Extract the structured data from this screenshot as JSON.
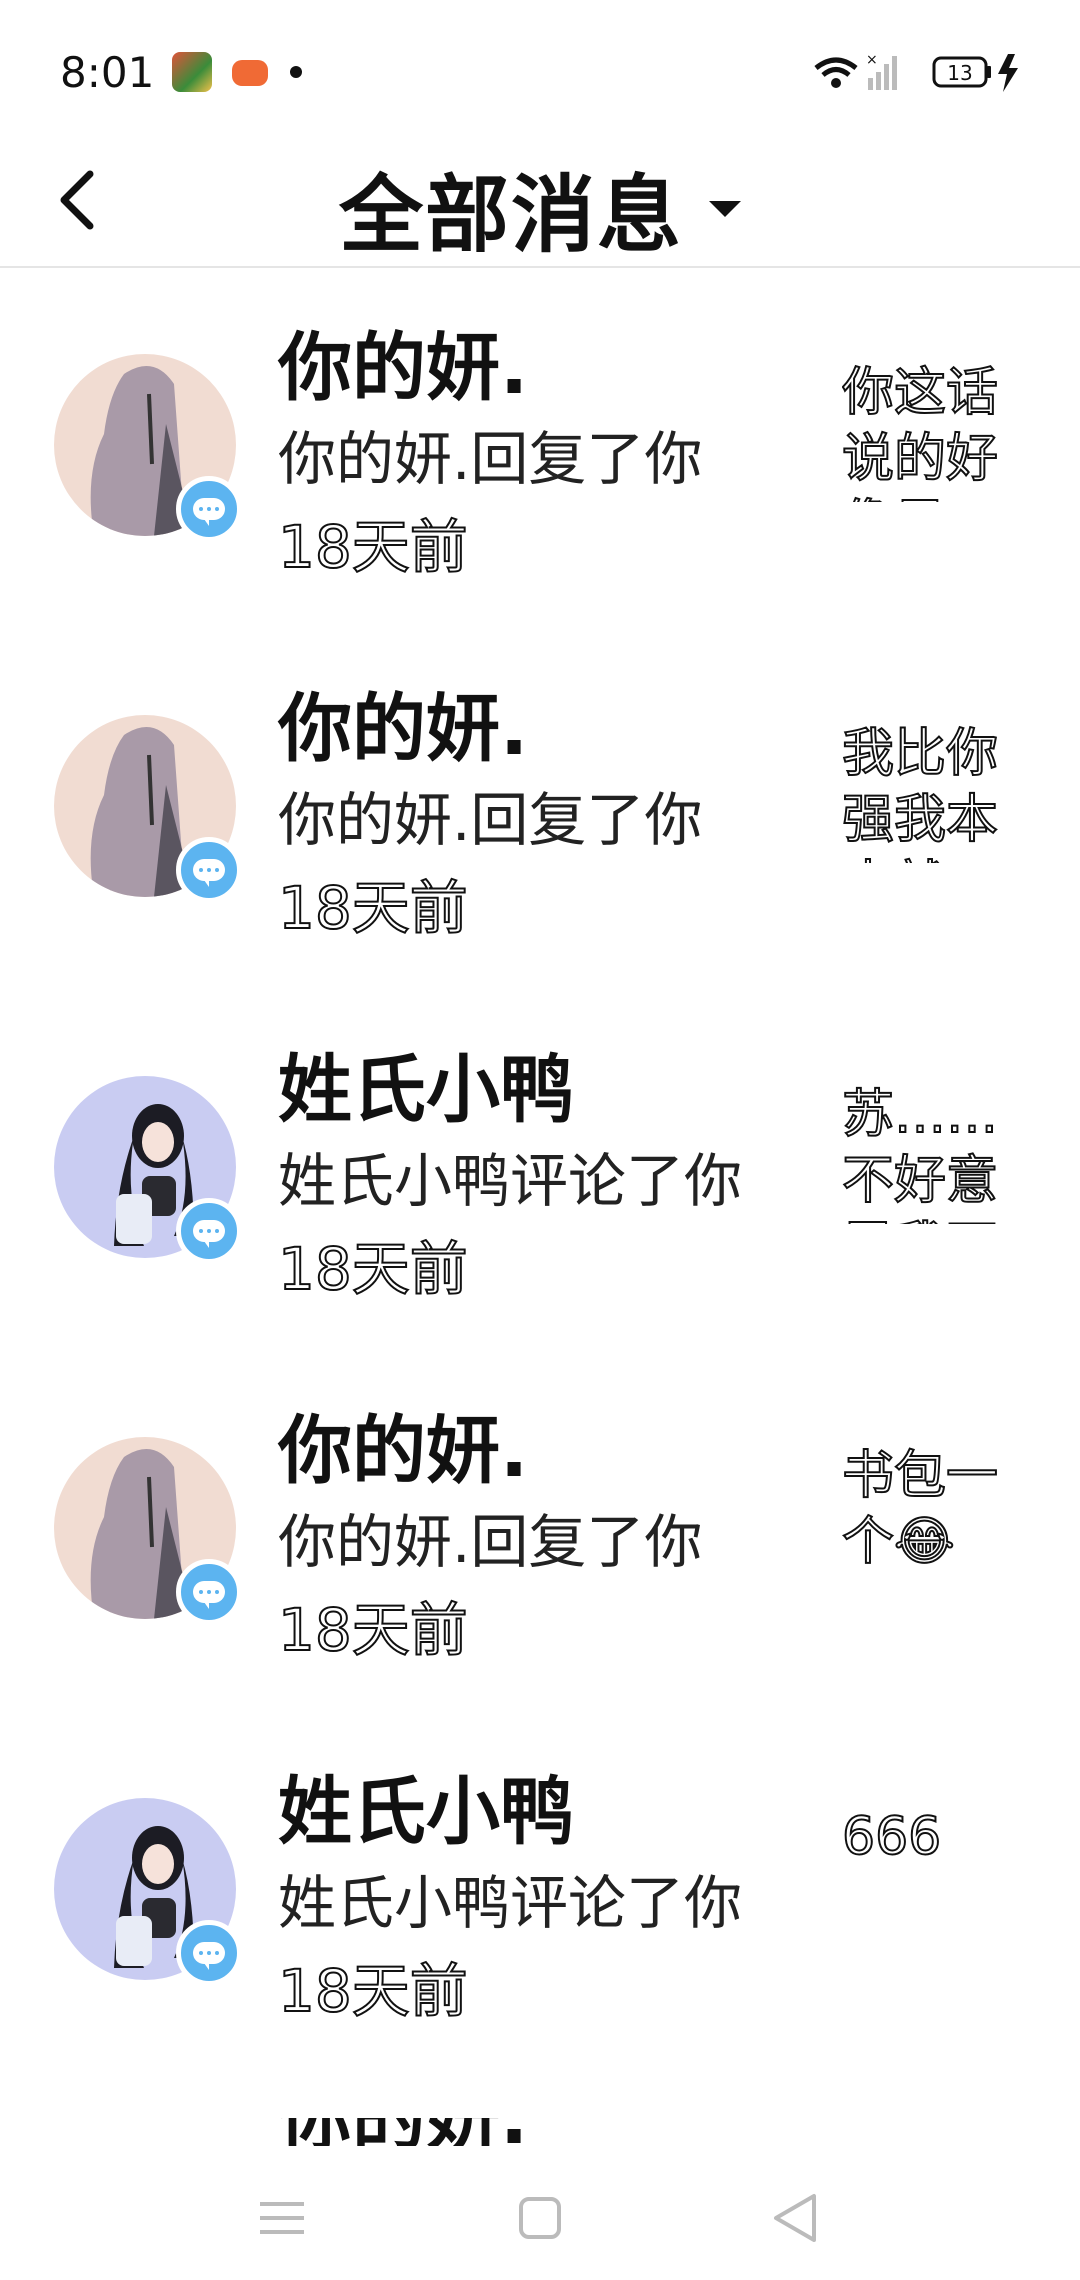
{
  "status_bar": {
    "time": "8:01",
    "battery": "13",
    "icons": [
      "game-app-icon",
      "gamepad-icon",
      "notification-dot",
      "wifi-icon",
      "signal-icon",
      "battery-icon",
      "charging-icon"
    ]
  },
  "header": {
    "title": "全部消息",
    "back_icon": "chevron-left-icon",
    "dropdown_icon": "caret-down-icon"
  },
  "messages": [
    {
      "name": "你的妍.",
      "action": "你的妍.回复了你",
      "time": "18天前",
      "preview": "你这话说的好像是",
      "avatar": "purple-hair"
    },
    {
      "name": "你的妍.",
      "action": "你的妍.回复了你",
      "time": "18天前",
      "preview": "我比你强我本来就",
      "avatar": "purple-hair"
    },
    {
      "name": "姓氏小鸭",
      "action": "姓氏小鸭评论了你",
      "time": "18天前",
      "preview": "苏……不好意思我不玩",
      "avatar": "black-hair"
    },
    {
      "name": "你的妍.",
      "action": "你的妍.回复了你",
      "time": "18天前",
      "preview": "书包一个😂",
      "avatar": "purple-hair"
    },
    {
      "name": "姓氏小鸭",
      "action": "姓氏小鸭评论了你",
      "time": "18天前",
      "preview": "666",
      "avatar": "black-hair"
    }
  ],
  "partial_item": {
    "name": "你的妍."
  },
  "nav": {
    "icons": [
      "menu-icon",
      "home-icon",
      "back-triangle-icon"
    ]
  },
  "colors": {
    "badge": "#5cb4f0",
    "avatar_purple_bg": "#f1dcd2",
    "avatar_black_bg": "#c9ccf2",
    "divider": "#e5e5e5"
  }
}
